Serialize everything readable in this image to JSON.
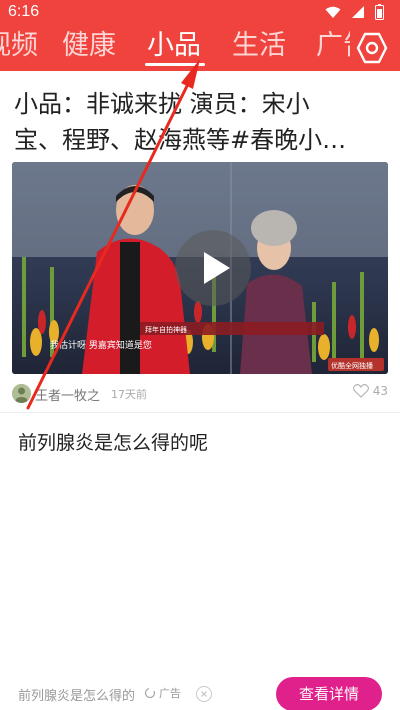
{
  "status_bar": {
    "time": "6:16",
    "icons": [
      "wifi-icon",
      "signal-icon",
      "battery-icon"
    ]
  },
  "tabs": [
    {
      "label": "视频",
      "active": false
    },
    {
      "label": "健康",
      "active": false
    },
    {
      "label": "小品",
      "active": true
    },
    {
      "label": "生活",
      "active": false
    },
    {
      "label": "广告",
      "active": false
    }
  ],
  "header": {
    "background": "#f0433d",
    "settings_icon": "hexagon-settings-icon"
  },
  "article": {
    "title_line1": "小品：非诚来扰 演员：宋小",
    "title_line2": "宝、程野、赵海燕等#春晚小…",
    "video": {
      "caption": "我估计呀   男嘉宾知道是您",
      "banner": "拜年自拍神器",
      "watermark": "优酷全网独播",
      "play_icon": "play-icon"
    },
    "author": "王者一牧之",
    "time_ago": "17天前",
    "likes": "43",
    "like_icon": "heart-icon"
  },
  "question": "前列腺炎是怎么得的呢",
  "ad": {
    "text": "前列腺炎是怎么得的",
    "tag": "广告",
    "tag_icon": "ad-logo-icon",
    "close_icon": "close-icon",
    "button_label": "查看详情",
    "button_color": "#e0208b"
  }
}
